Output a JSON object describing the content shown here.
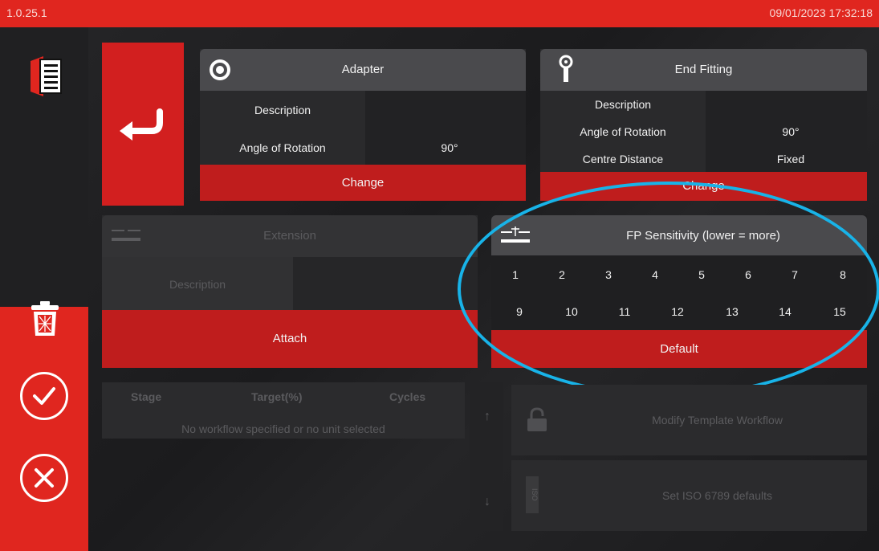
{
  "status_bar": {
    "version": "1.0.25.1",
    "datetime": "09/01/2023 17:32:18"
  },
  "sidebar": {
    "icons": [
      "document-icon",
      "trash-icon",
      "confirm-icon",
      "cancel-icon"
    ]
  },
  "adapter": {
    "title": "Adapter",
    "rows": [
      {
        "label": "Description",
        "value": ""
      },
      {
        "label": "Angle of Rotation",
        "value": "90°"
      }
    ],
    "button": "Change"
  },
  "end_fitting": {
    "title": "End Fitting",
    "rows": [
      {
        "label": "Description",
        "value": ""
      },
      {
        "label": "Angle of Rotation",
        "value": "90°"
      },
      {
        "label": "Centre Distance",
        "value": "Fixed"
      }
    ],
    "button": "Change"
  },
  "extension": {
    "title": "Extension",
    "rows": [
      {
        "label": "Description",
        "value": ""
      }
    ],
    "button": "Attach"
  },
  "fp_sensitivity": {
    "title": "FP Sensitivity (lower = more)",
    "row1": [
      "1",
      "2",
      "3",
      "4",
      "5",
      "6",
      "7",
      "8"
    ],
    "row2": [
      "9",
      "10",
      "11",
      "12",
      "13",
      "14",
      "15"
    ],
    "button": "Default"
  },
  "workflow": {
    "headers": [
      "Stage",
      "Target(%)",
      "Cycles"
    ],
    "message": "No workflow specified or no unit selected",
    "modify_button": "Modify Template Workflow",
    "iso_button": "Set ISO 6789 defaults",
    "iso_icon_text": "ISO"
  },
  "colors": {
    "accent": "#e0261f",
    "highlight": "#18b3e8"
  }
}
